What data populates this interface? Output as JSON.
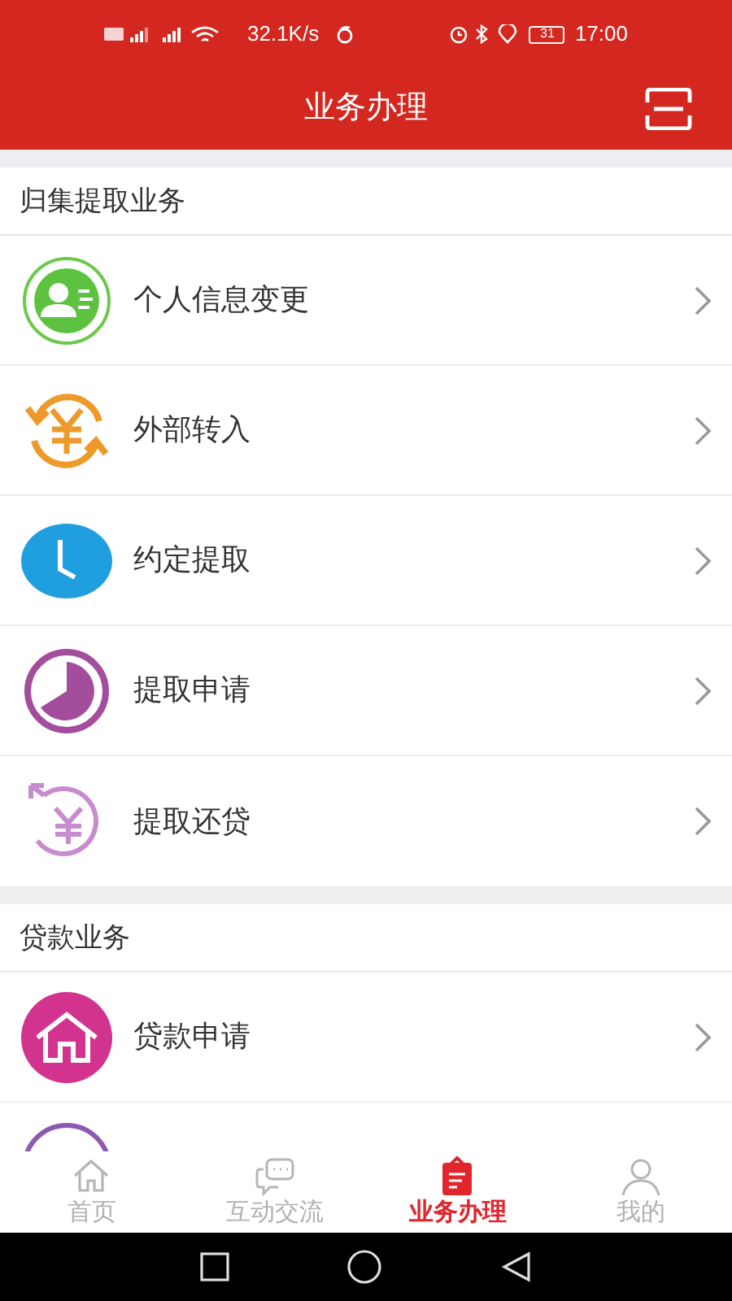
{
  "status_bar": {
    "speed": "32.1K/s",
    "battery": "31",
    "time": "17:00"
  },
  "header": {
    "title": "业务办理"
  },
  "sections": [
    {
      "title": "归集提取业务",
      "items": [
        {
          "kind": "person",
          "label": "个人信息变更"
        },
        {
          "kind": "exchange",
          "label": "外部转入"
        },
        {
          "kind": "clock",
          "label": "约定提取"
        },
        {
          "kind": "pie",
          "label": "提取申请"
        },
        {
          "kind": "repay",
          "label": "提取还贷"
        }
      ]
    },
    {
      "title": "贷款业务",
      "items": [
        {
          "kind": "house",
          "label": "贷款申请"
        },
        {
          "kind": "partial"
        }
      ]
    }
  ],
  "tabs": [
    {
      "kind": "home",
      "label": "首页",
      "selected": false
    },
    {
      "kind": "chat",
      "label": "互动交流",
      "selected": false
    },
    {
      "kind": "clipboard",
      "label": "业务办理",
      "selected": true
    },
    {
      "kind": "user",
      "label": "我的",
      "selected": false
    }
  ]
}
